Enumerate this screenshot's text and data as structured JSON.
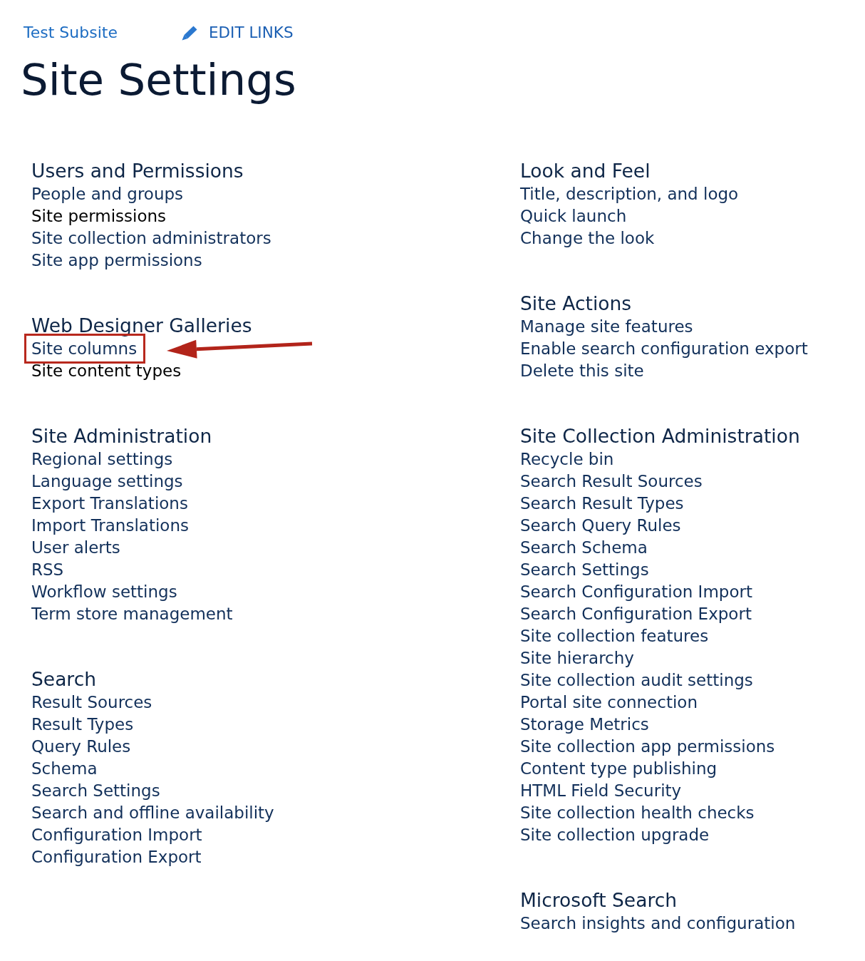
{
  "breadcrumb": {
    "site_link": "Test Subsite",
    "edit_links": "EDIT LINKS"
  },
  "page_title": "Site Settings",
  "columns": [
    {
      "sections": [
        {
          "heading": "Users and Permissions",
          "links": [
            {
              "label": "People and groups",
              "visited": false,
              "highlighted": false
            },
            {
              "label": "Site permissions",
              "visited": true,
              "highlighted": false
            },
            {
              "label": "Site collection administrators",
              "visited": false,
              "highlighted": false
            },
            {
              "label": "Site app permissions",
              "visited": false,
              "highlighted": false
            }
          ]
        },
        {
          "heading": "Web Designer Galleries",
          "links": [
            {
              "label": "Site columns",
              "visited": false,
              "highlighted": true
            },
            {
              "label": "Site content types",
              "visited": true,
              "highlighted": false
            }
          ]
        },
        {
          "heading": "Site Administration",
          "links": [
            {
              "label": "Regional settings",
              "visited": false,
              "highlighted": false
            },
            {
              "label": "Language settings",
              "visited": false,
              "highlighted": false
            },
            {
              "label": "Export Translations",
              "visited": false,
              "highlighted": false
            },
            {
              "label": "Import Translations",
              "visited": false,
              "highlighted": false
            },
            {
              "label": "User alerts",
              "visited": false,
              "highlighted": false
            },
            {
              "label": "RSS",
              "visited": false,
              "highlighted": false
            },
            {
              "label": "Workflow settings",
              "visited": false,
              "highlighted": false
            },
            {
              "label": "Term store management",
              "visited": false,
              "highlighted": false
            }
          ]
        },
        {
          "heading": "Search",
          "links": [
            {
              "label": "Result Sources",
              "visited": false,
              "highlighted": false
            },
            {
              "label": "Result Types",
              "visited": false,
              "highlighted": false
            },
            {
              "label": "Query Rules",
              "visited": false,
              "highlighted": false
            },
            {
              "label": "Schema",
              "visited": false,
              "highlighted": false
            },
            {
              "label": "Search Settings",
              "visited": false,
              "highlighted": false
            },
            {
              "label": "Search and offline availability",
              "visited": false,
              "highlighted": false
            },
            {
              "label": "Configuration Import",
              "visited": false,
              "highlighted": false
            },
            {
              "label": "Configuration Export",
              "visited": false,
              "highlighted": false
            }
          ]
        }
      ]
    },
    {
      "sections": [
        {
          "heading": "Look and Feel",
          "links": [
            {
              "label": "Title, description, and logo",
              "visited": false,
              "highlighted": false
            },
            {
              "label": "Quick launch",
              "visited": false,
              "highlighted": false
            },
            {
              "label": "Change the look",
              "visited": false,
              "highlighted": false
            }
          ]
        },
        {
          "heading": "Site Actions",
          "links": [
            {
              "label": "Manage site features",
              "visited": false,
              "highlighted": false
            },
            {
              "label": "Enable search configuration export",
              "visited": false,
              "highlighted": false
            },
            {
              "label": "Delete this site",
              "visited": false,
              "highlighted": false
            }
          ]
        },
        {
          "heading": "Site Collection Administration",
          "links": [
            {
              "label": "Recycle bin",
              "visited": false,
              "highlighted": false
            },
            {
              "label": "Search Result Sources",
              "visited": false,
              "highlighted": false
            },
            {
              "label": "Search Result Types",
              "visited": false,
              "highlighted": false
            },
            {
              "label": "Search Query Rules",
              "visited": false,
              "highlighted": false
            },
            {
              "label": "Search Schema",
              "visited": false,
              "highlighted": false
            },
            {
              "label": "Search Settings",
              "visited": false,
              "highlighted": false
            },
            {
              "label": "Search Configuration Import",
              "visited": false,
              "highlighted": false
            },
            {
              "label": "Search Configuration Export",
              "visited": false,
              "highlighted": false
            },
            {
              "label": "Site collection features",
              "visited": false,
              "highlighted": false
            },
            {
              "label": "Site hierarchy",
              "visited": false,
              "highlighted": false
            },
            {
              "label": "Site collection audit settings",
              "visited": false,
              "highlighted": false
            },
            {
              "label": "Portal site connection",
              "visited": false,
              "highlighted": false
            },
            {
              "label": "Storage Metrics",
              "visited": false,
              "highlighted": false
            },
            {
              "label": "Site collection app permissions",
              "visited": false,
              "highlighted": false
            },
            {
              "label": "Content type publishing",
              "visited": false,
              "highlighted": false
            },
            {
              "label": "HTML Field Security",
              "visited": false,
              "highlighted": false
            },
            {
              "label": "Site collection health checks",
              "visited": false,
              "highlighted": false
            },
            {
              "label": "Site collection upgrade",
              "visited": false,
              "highlighted": false
            }
          ]
        },
        {
          "heading": "Microsoft Search",
          "links": [
            {
              "label": "Search insights and configuration",
              "visited": false,
              "highlighted": false
            }
          ]
        }
      ]
    }
  ]
}
